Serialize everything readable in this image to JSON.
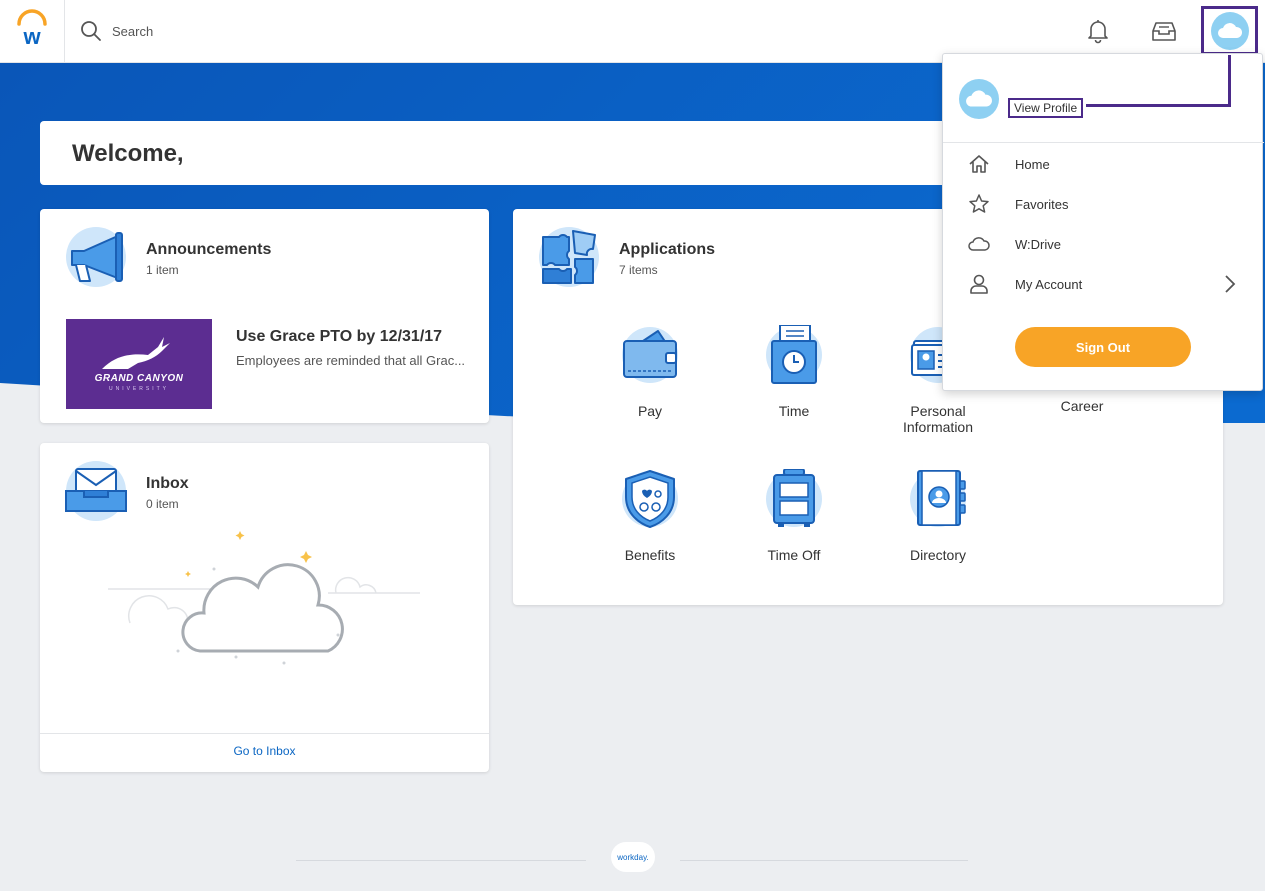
{
  "header": {
    "search_label": "Search"
  },
  "welcome": {
    "title": "Welcome,"
  },
  "announcements": {
    "title": "Announcements",
    "count": "1 item",
    "item": {
      "image_text": "GRAND CANYON",
      "image_subtext": "UNIVERSITY",
      "headline": "Use Grace PTO by 12/31/17",
      "body": "Employees are reminded that all Grac..."
    }
  },
  "inbox": {
    "title": "Inbox",
    "count": "0 item",
    "link": "Go to Inbox"
  },
  "applications": {
    "title": "Applications",
    "count": "7 items",
    "apps": [
      {
        "label": "Pay",
        "icon": "wallet-icon"
      },
      {
        "label": "Time",
        "icon": "time-clock-icon"
      },
      {
        "label": "Personal\nInformation",
        "icon": "id-card-icon"
      },
      {
        "label": "Career",
        "icon": "career-icon"
      },
      {
        "label": "Benefits",
        "icon": "benefits-shield-icon"
      },
      {
        "label": "Time Off",
        "icon": "suitcase-icon"
      },
      {
        "label": "Directory",
        "icon": "directory-book-icon"
      }
    ]
  },
  "menu": {
    "view_profile": "View Profile",
    "items": [
      {
        "label": "Home",
        "icon": "home-icon"
      },
      {
        "label": "Favorites",
        "icon": "star-icon"
      },
      {
        "label": "W:Drive",
        "icon": "cloud-icon"
      },
      {
        "label": "My Account",
        "icon": "user-icon"
      }
    ],
    "sign_out": "Sign Out"
  },
  "footer": {
    "logo_text": "workday."
  },
  "colors": {
    "brand_blue": "#0b66c3",
    "banner_blue": "#0862c8",
    "accent_orange": "#f8a426",
    "highlight_purple": "#4b2a8a",
    "avatar_blue": "#8ed0f2"
  }
}
